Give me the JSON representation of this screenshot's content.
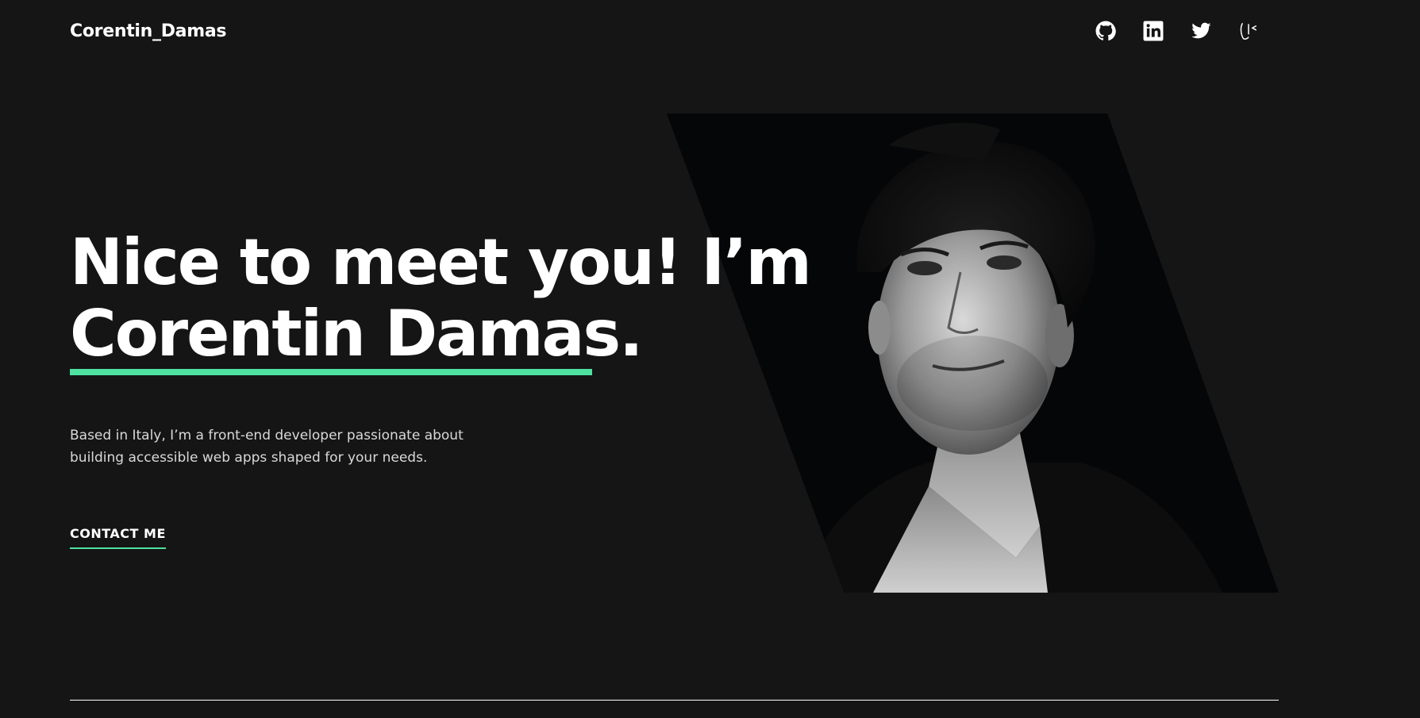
{
  "header": {
    "logo": "Corentin_Damas",
    "social_links": [
      {
        "name": "github",
        "icon": "github-icon"
      },
      {
        "name": "linkedin",
        "icon": "linkedin-icon"
      },
      {
        "name": "twitter",
        "icon": "twitter-icon"
      },
      {
        "name": "custom",
        "icon": "brand-logo-icon"
      }
    ]
  },
  "hero": {
    "headline_line1": "Nice to meet you! I’m",
    "headline_line2": "Corentin Damas.",
    "bio": "Based in Italy, I’m a front-end developer passionate about building accessible web apps shaped for your needs.",
    "contact_label": "CONTACT ME",
    "portrait_alt": "Corentin Damas"
  },
  "colors": {
    "background": "#151515",
    "accent": "#4ee1a0",
    "text": "#ffffff",
    "muted_text": "#d9d9d9"
  }
}
